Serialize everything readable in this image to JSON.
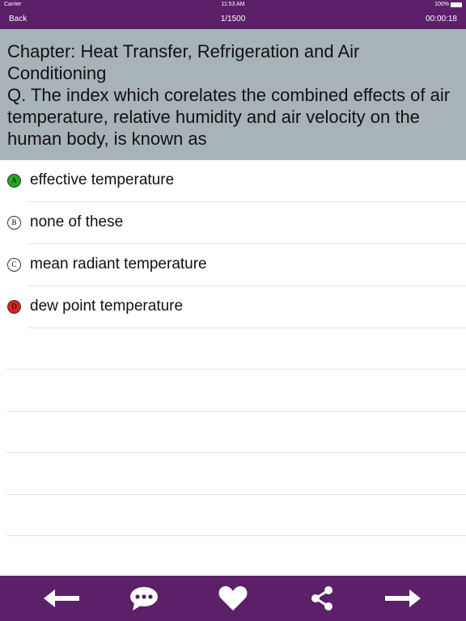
{
  "status_bar": {
    "carrier": "Carrier",
    "time": "11:53 AM",
    "battery": "100%"
  },
  "nav": {
    "back_label": "Back",
    "counter": "1/1500",
    "timer": "00:00:18"
  },
  "question": {
    "chapter": "Chapter: Heat Transfer, Refrigeration and Air Conditioning",
    "text": "Q. The index which corelates the combined effects of air temperature, relative humidity and air velocity on the human body, is known as"
  },
  "options": [
    {
      "letter": "A",
      "text": "effective temperature",
      "state": "correct",
      "color": "#22aa22"
    },
    {
      "letter": "B",
      "text": "none of these",
      "state": "neutral",
      "color": "#ffffff"
    },
    {
      "letter": "C",
      "text": "mean radiant temperature",
      "state": "neutral",
      "color": "#ffffff"
    },
    {
      "letter": "D",
      "text": "dew point temperature",
      "state": "wrong",
      "color": "#e02020"
    }
  ],
  "toolbar": {
    "icons": [
      "arrow-left-icon",
      "chat-icon",
      "heart-icon",
      "share-icon",
      "arrow-right-icon"
    ]
  },
  "colors": {
    "brand": "#5b2068",
    "question_bg": "#a8b3b8"
  }
}
